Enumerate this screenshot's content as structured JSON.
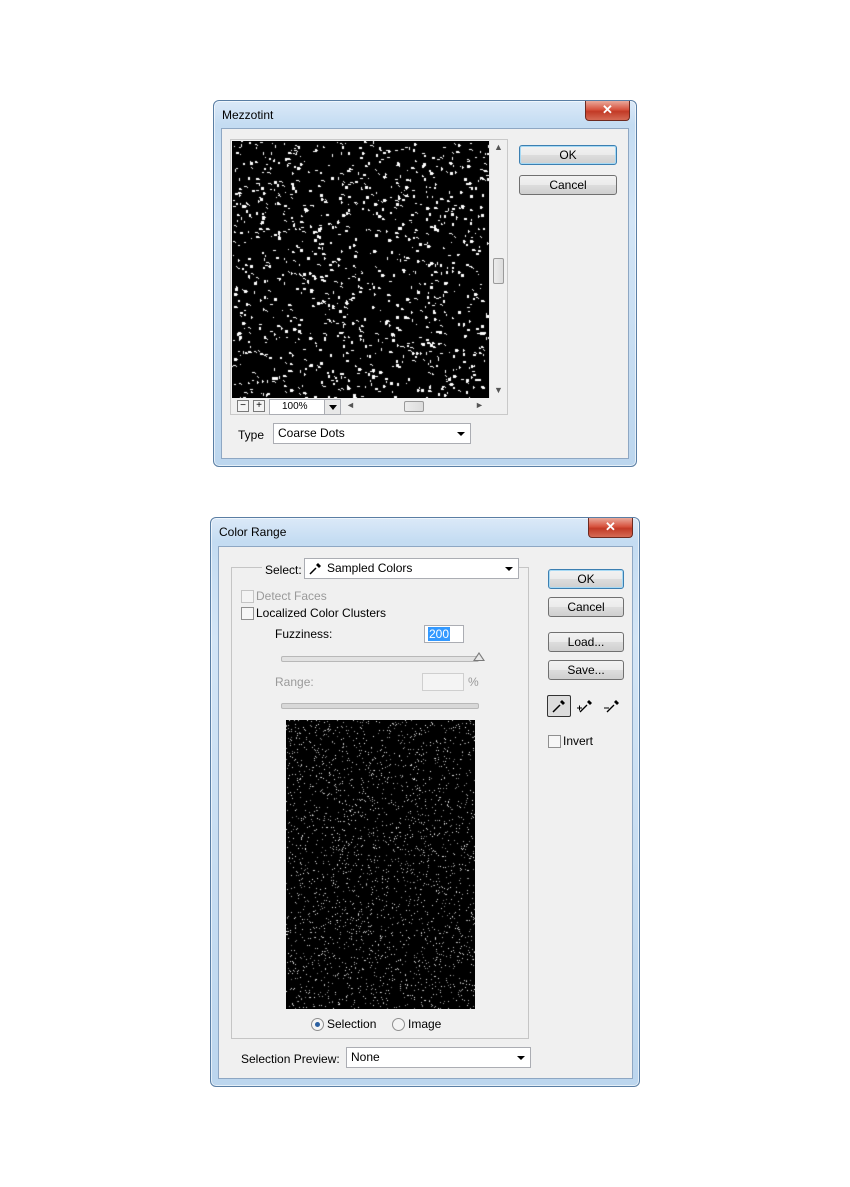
{
  "mezzotint": {
    "title": "Mezzotint",
    "close_glyph": "✕",
    "ok_label": "OK",
    "cancel_label": "Cancel",
    "zoom_minus": "−",
    "zoom_plus": "+",
    "zoom_value": "100%",
    "type_label": "Type",
    "type_value": "Coarse Dots"
  },
  "color_range": {
    "title": "Color Range",
    "close_glyph": "✕",
    "select_label": "Select:",
    "select_value": "Sampled Colors",
    "detect_faces_label": "Detect Faces",
    "localized_label": "Localized Color Clusters",
    "fuzziness_label": "Fuzziness:",
    "fuzziness_value": "200",
    "range_label": "Range:",
    "range_unit": "%",
    "selection_label": "Selection",
    "image_label": "Image",
    "ok_label": "OK",
    "cancel_label": "Cancel",
    "load_label": "Load...",
    "save_label": "Save...",
    "invert_label": "Invert",
    "preview_label": "Selection Preview:",
    "preview_value": "None"
  },
  "colors": {
    "window_frame": "#5a7ea4",
    "close_red": "#c23a26",
    "default_button_border": "#3c7fb1",
    "selection_highlight": "#3399ff"
  },
  "icons": [
    "close-icon",
    "eyedropper-icon",
    "eyedropper-plus-icon",
    "eyedropper-minus-icon",
    "dropdown-arrow-icon",
    "scroll-arrow-icon"
  ]
}
